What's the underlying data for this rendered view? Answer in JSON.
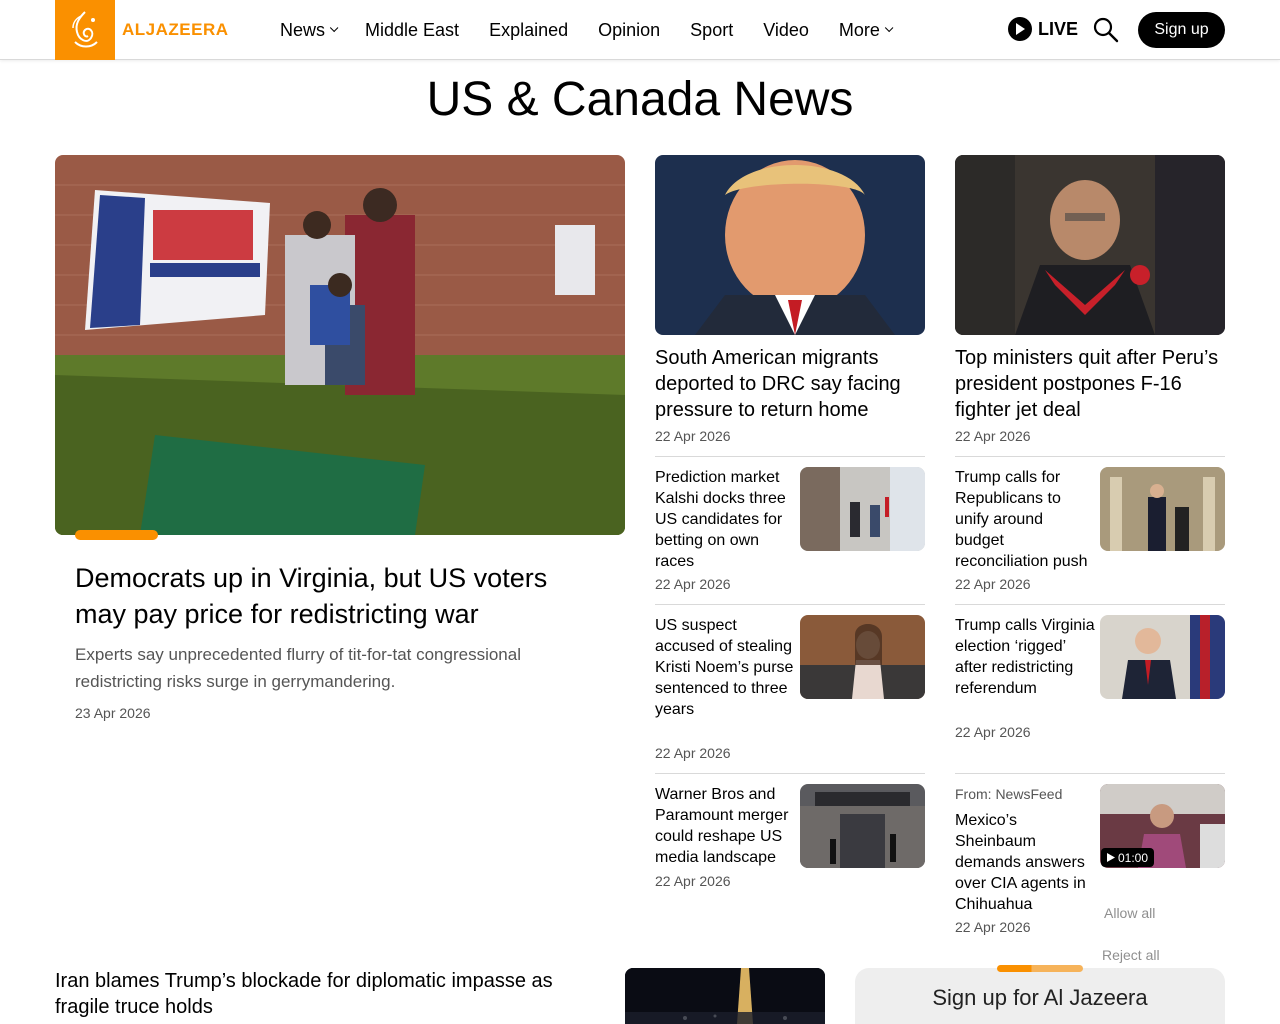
{
  "header": {
    "logo_text": "ALJAZEERA",
    "nav": [
      {
        "label": "News",
        "dropdown": true
      },
      {
        "label": "Middle East",
        "dropdown": false
      },
      {
        "label": "Explained",
        "dropdown": false
      },
      {
        "label": "Opinion",
        "dropdown": false
      },
      {
        "label": "Sport",
        "dropdown": false
      },
      {
        "label": "Video",
        "dropdown": false
      },
      {
        "label": "More",
        "dropdown": true
      }
    ],
    "live_label": "LIVE",
    "signup_label": "Sign up",
    "brand_color": "#fa9000"
  },
  "page_title": "US & Canada News",
  "featured": {
    "title": "Democrats up in Virginia, but US voters may pay price for redistricting war",
    "description": "Experts say unprecedented flurry of tit-for-tat congressional redistricting risks surge in gerrymandering.",
    "date": "23 Apr 2026"
  },
  "top_cards": [
    {
      "title": "South American migrants deported to DRC say facing pressure to return home",
      "date": "22 Apr 2026"
    },
    {
      "title": "Top ministers quit after Peru’s president postpones F-16 fighter jet deal",
      "date": "22 Apr 2026"
    }
  ],
  "col2_items": [
    {
      "title": "Prediction market Kalshi docks three US candidates for betting on own races",
      "date": "22 Apr 2026"
    },
    {
      "title": "US suspect accused of stealing Kristi Noem’s purse sentenced to three years",
      "date": "22 Apr 2026"
    },
    {
      "title": "Warner Bros and Paramount merger could reshape US media landscape",
      "date": "22 Apr 2026"
    }
  ],
  "col3_items": [
    {
      "title": "Trump calls for Republicans to unify around budget reconciliation push",
      "date": "22 Apr 2026"
    },
    {
      "title": "Trump calls Virginia election ‘rigged’ after redistricting referendum",
      "date": "22 Apr 2026"
    },
    {
      "source": "From: NewsFeed",
      "title": "Mexico’s Sheinbaum demands answers over CIA agents in Chihuahua",
      "date": "22 Apr 2026",
      "video_duration": "01:00"
    }
  ],
  "cookie": {
    "allow_all": "Allow all",
    "reject_all": "Reject all"
  },
  "bottom": {
    "title": "Iran blames Trump’s blockade for diplomatic impasse as fragile truce holds",
    "signup_title": "Sign up for Al Jazeera"
  }
}
